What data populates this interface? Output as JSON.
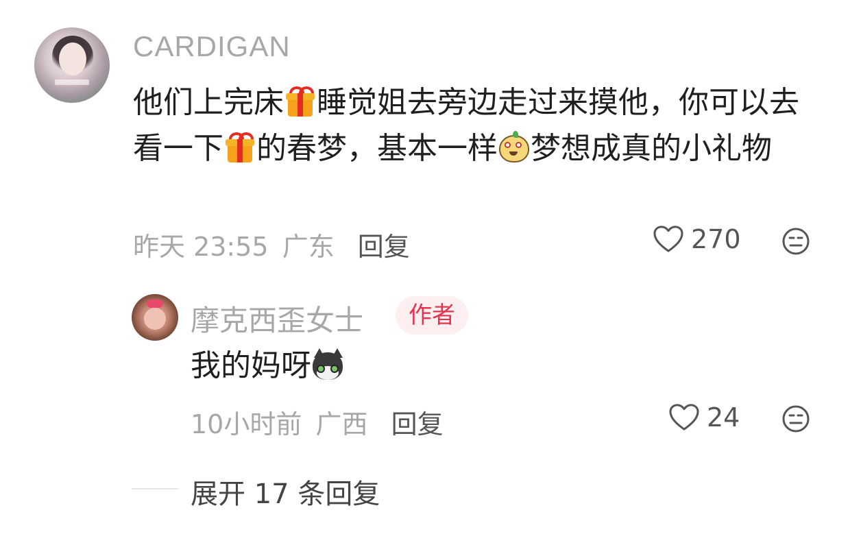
{
  "comment": {
    "username": "CARDIGAN",
    "text_parts": {
      "p1": "他们上完床",
      "p2": "睡觉姐去旁边走过来摸他，你可以去看一下",
      "p3": "的春梦，基本一样",
      "p4": "梦想成真的小礼物"
    },
    "icons": [
      "gift-emoji",
      "gift-emoji",
      "bun-face-emoji"
    ],
    "time": "昨天 23:55",
    "location": "广东",
    "reply_label": "回复",
    "like_count": "270"
  },
  "reply": {
    "username": "摩克西歪女士",
    "badge": "作者",
    "text": "我的妈呀",
    "icons": [
      "cat-emoji"
    ],
    "time": "10小时前",
    "location": "广西",
    "reply_label": "回复",
    "like_count": "24"
  },
  "expand": {
    "label": "展开 17 条回复"
  },
  "colors": {
    "meta_gray": "#a7a7a7",
    "text": "#1f1f1f",
    "badge_red": "#e5344e",
    "badge_bg": "#fdeef0"
  }
}
